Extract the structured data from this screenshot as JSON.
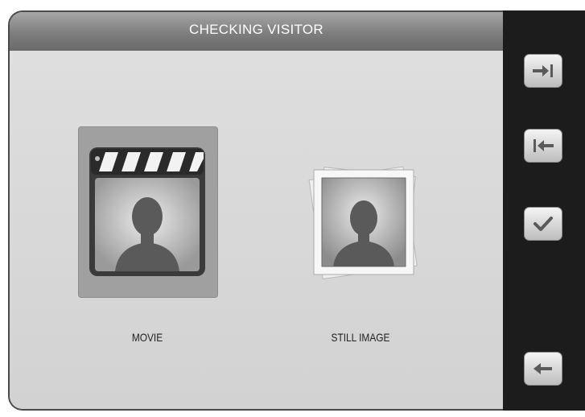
{
  "header": {
    "title": "CHECKING VISITOR"
  },
  "options": [
    {
      "label": "MOVIE",
      "icon": "movie-clapper-icon",
      "selected": true
    },
    {
      "label": "STILL IMAGE",
      "icon": "photo-stack-icon",
      "selected": false
    }
  ],
  "sidebar": {
    "buttons": [
      {
        "icon": "arrow-to-end-icon"
      },
      {
        "icon": "arrow-to-start-icon"
      },
      {
        "icon": "checkmark-icon"
      },
      {
        "icon": "back-arrow-icon"
      }
    ]
  },
  "colors": {
    "title_bar": "#7e7e7e",
    "screen_bg": "#d6d6d6",
    "side_panel": "#1c1c1c",
    "selected_tile": "#a0a0a0"
  }
}
